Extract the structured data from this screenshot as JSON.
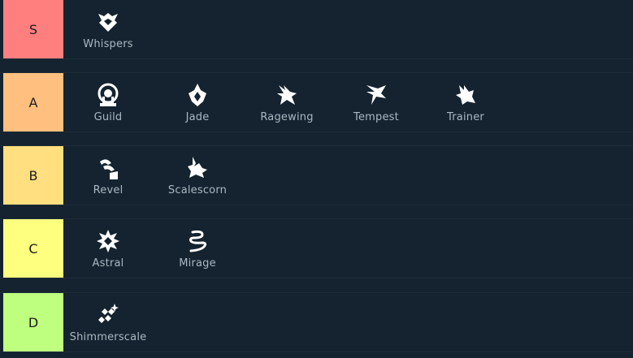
{
  "colors": {
    "background": "#14232f",
    "row_border": "#1d2c39",
    "item_text": "#a9b8c2",
    "icon": "#ffffff"
  },
  "tiers": [
    {
      "label": "S",
      "color": "#ff7f7f",
      "items": [
        {
          "label": "Whispers",
          "icon": "whispers-icon"
        }
      ]
    },
    {
      "label": "A",
      "color": "#ffbf7f",
      "items": [
        {
          "label": "Guild",
          "icon": "guild-icon"
        },
        {
          "label": "Jade",
          "icon": "jade-icon"
        },
        {
          "label": "Ragewing",
          "icon": "ragewing-icon"
        },
        {
          "label": "Tempest",
          "icon": "tempest-icon"
        },
        {
          "label": "Trainer",
          "icon": "trainer-icon"
        }
      ]
    },
    {
      "label": "B",
      "color": "#ffdf7f",
      "items": [
        {
          "label": "Revel",
          "icon": "revel-icon"
        },
        {
          "label": "Scalescorn",
          "icon": "scalescorn-icon"
        }
      ]
    },
    {
      "label": "C",
      "color": "#ffff7f",
      "items": [
        {
          "label": "Astral",
          "icon": "astral-icon"
        },
        {
          "label": "Mirage",
          "icon": "mirage-icon"
        }
      ]
    },
    {
      "label": "D",
      "color": "#bfff7f",
      "items": [
        {
          "label": "Shimmerscale",
          "icon": "shimmerscale-icon"
        }
      ]
    }
  ]
}
